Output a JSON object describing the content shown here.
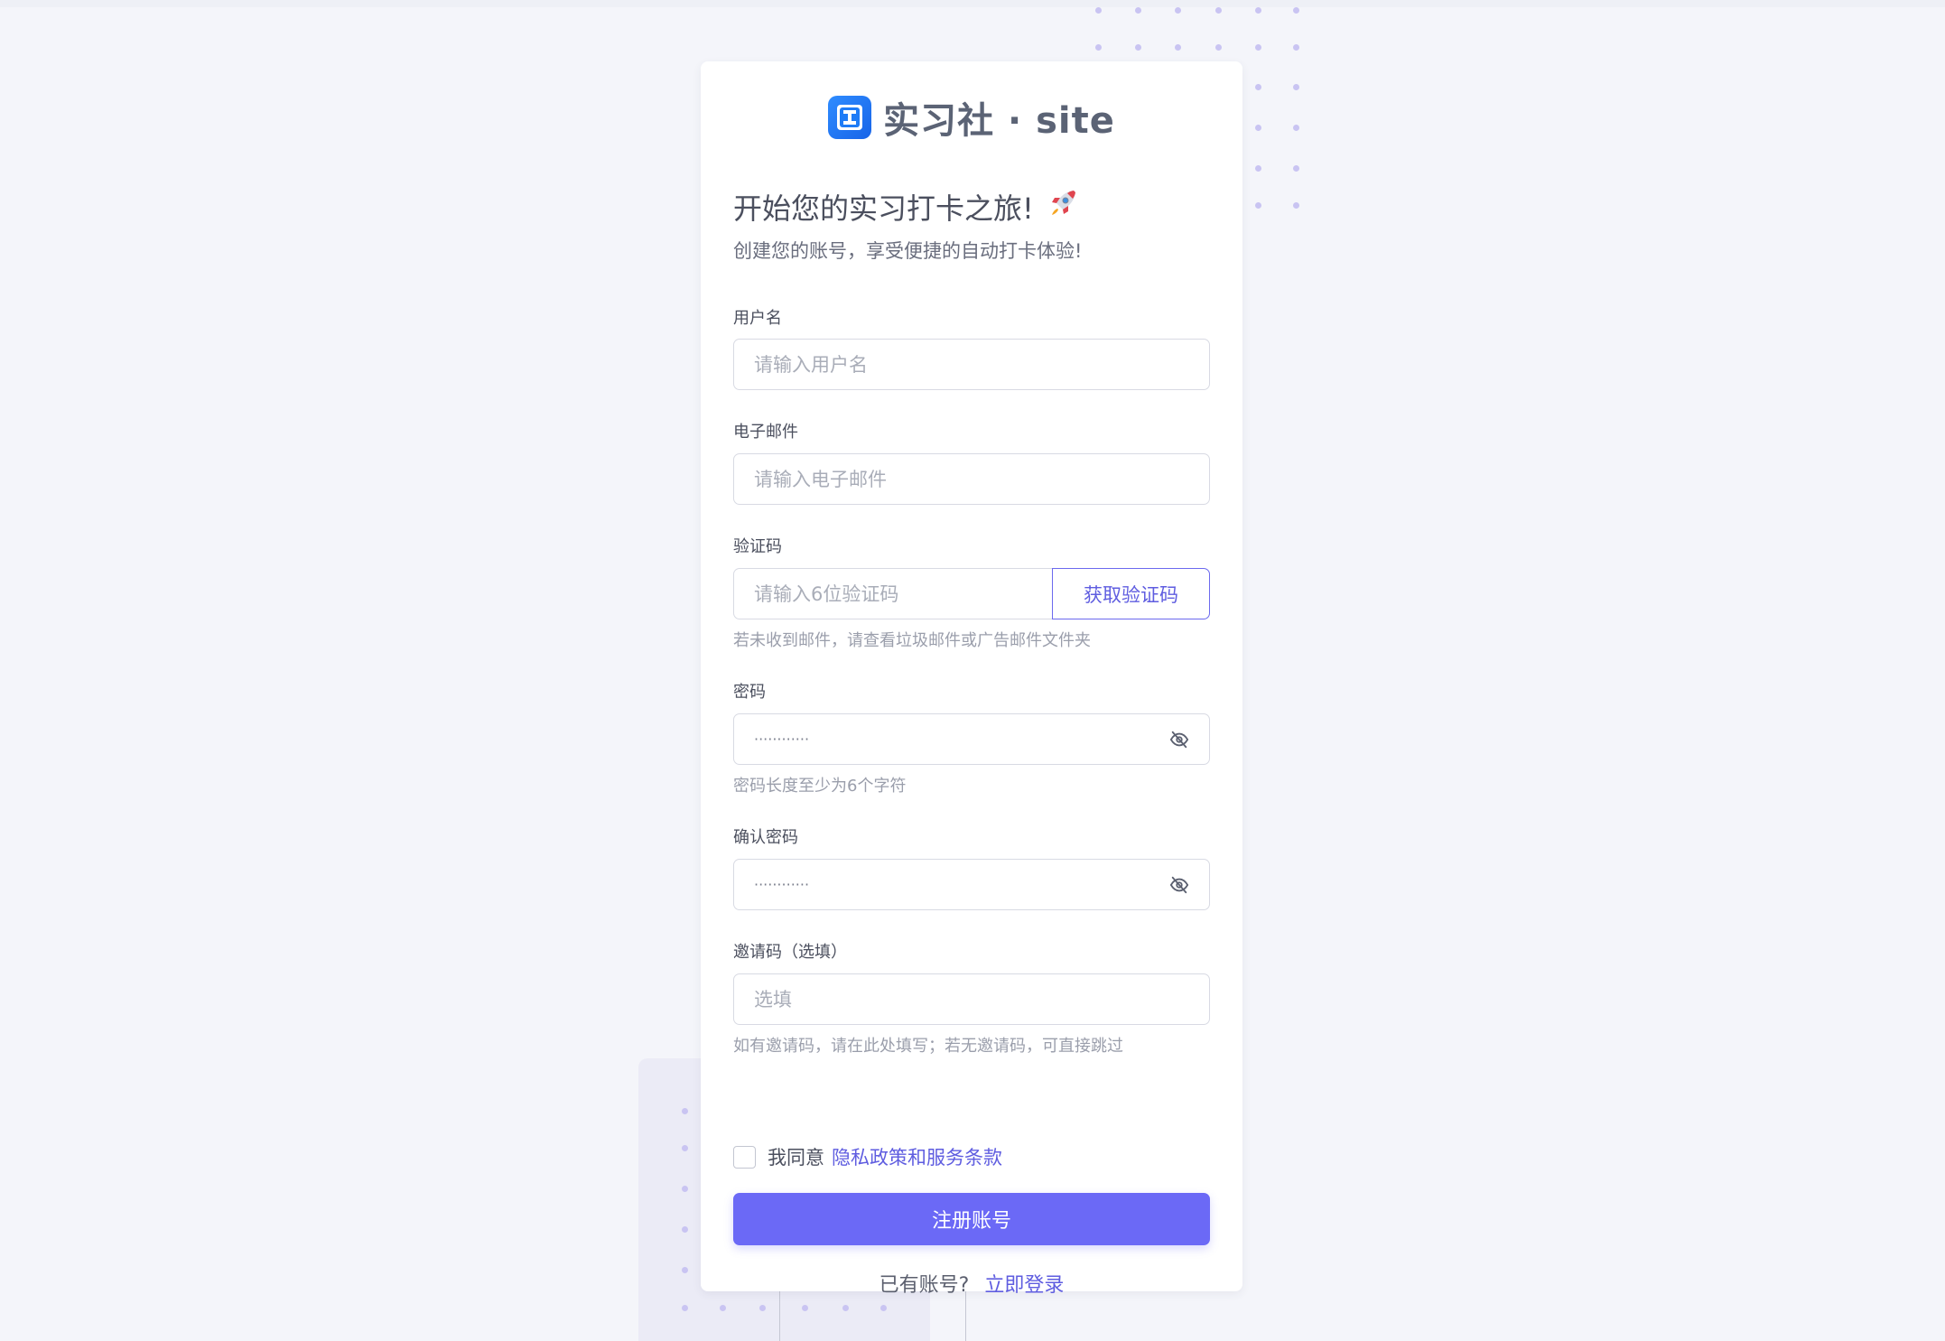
{
  "brand": {
    "name": "实习社 · site",
    "logo_glyph": "I",
    "logo_color": "#1f7cf6"
  },
  "heading": {
    "title": "开始您的实习打卡之旅!",
    "emoji": "🚀",
    "subtitle": "创建您的账号，享受便捷的自动打卡体验!"
  },
  "form": {
    "username": {
      "label": "用户名",
      "placeholder": "请输入用户名",
      "value": ""
    },
    "email": {
      "label": "电子邮件",
      "placeholder": "请输入电子邮件",
      "value": ""
    },
    "code": {
      "label": "验证码",
      "placeholder": "请输入6位验证码",
      "value": "",
      "button_label": "获取验证码",
      "hint": "若未收到邮件，请查看垃圾邮件或广告邮件文件夹"
    },
    "password": {
      "label": "密码",
      "masked_value": "············",
      "hint": "密码长度至少为6个字符",
      "toggle_icon": "eye-off-icon"
    },
    "confirm_password": {
      "label": "确认密码",
      "masked_value": "············",
      "toggle_icon": "eye-off-icon"
    },
    "invite": {
      "label": "邀请码（选填）",
      "placeholder": "选填",
      "value": "",
      "hint": "如有邀请码，请在此处填写；若无邀请码，可直接跳过"
    },
    "agree": {
      "text": "我同意",
      "link": "隐私政策和服务条款",
      "checked": false
    },
    "submit_label": "注册账号"
  },
  "footer": {
    "question": "已有账号?",
    "login_link": "立即登录"
  },
  "colors": {
    "accent": "#6b69f6",
    "link": "#5f5de0",
    "page_bg": "#f4f5fa",
    "card_bg": "#ffffff"
  }
}
